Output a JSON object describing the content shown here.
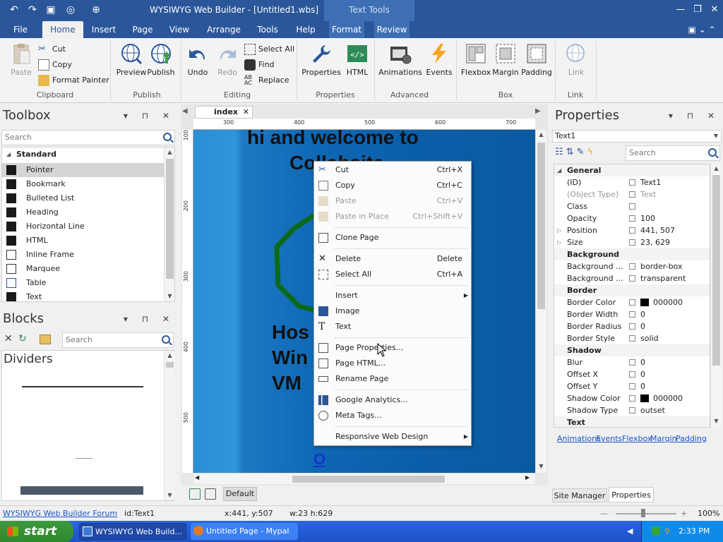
{
  "window": {
    "title": "WYSIWYG Web Builder - [Untitled1.wbs]",
    "context_tab": "Text Tools",
    "min": "—",
    "restore": "❐",
    "close": "✕"
  },
  "ribbon_tabs": [
    "File",
    "Home",
    "Insert",
    "Page",
    "View",
    "Arrange",
    "Tools",
    "Help",
    "Format",
    "Review"
  ],
  "ribbon": {
    "clipboard": {
      "paste": "Paste",
      "cut": "Cut",
      "copy": "Copy",
      "format_painter": "Format Painter",
      "label": "Clipboard"
    },
    "publish": {
      "preview": "Preview",
      "publish": "Publish",
      "label": "Publish"
    },
    "editing": {
      "undo": "Undo",
      "redo": "Redo",
      "select_all": "Select All",
      "find": "Find",
      "replace": "Replace",
      "label": "Editing"
    },
    "properties": {
      "properties": "Properties",
      "html": "HTML",
      "label": "Properties"
    },
    "advanced": {
      "animations": "Animations",
      "events": "Events",
      "label": "Advanced"
    },
    "box": {
      "flexbox": "Flexbox",
      "margin": "Margin",
      "padding": "Padding",
      "label": "Box"
    },
    "link": {
      "link": "Link",
      "label": "Link"
    }
  },
  "toolbox": {
    "title": "Toolbox",
    "search_placeholder": "Search",
    "category": "Standard",
    "items": [
      "Pointer",
      "Bookmark",
      "Bulleted List",
      "Heading",
      "Horizontal Line",
      "HTML",
      "Inline Frame",
      "Marquee",
      "Table",
      "Text"
    ]
  },
  "blocks": {
    "title": "Blocks",
    "search_placeholder": "Search",
    "category": "Dividers"
  },
  "document": {
    "tab": "index",
    "ruler_h": [
      "300",
      "400",
      "500",
      "600",
      "700"
    ],
    "ruler_v": [
      "100",
      "200",
      "300",
      "400",
      "500"
    ],
    "heading1": "hi and welcome to",
    "heading2": "Collabsite",
    "side_text1": "Hos",
    "side_text2": "Win",
    "side_text3": "VM",
    "link_text": "O",
    "layer": "Default"
  },
  "context_menu": {
    "items": [
      {
        "label": "Cut",
        "shortcut": "Ctrl+X",
        "enabled": true
      },
      {
        "label": "Copy",
        "shortcut": "Ctrl+C",
        "enabled": true
      },
      {
        "label": "Paste",
        "shortcut": "Ctrl+V",
        "enabled": false
      },
      {
        "label": "Paste in Place",
        "shortcut": "Ctrl+Shift+V",
        "enabled": false
      },
      {
        "label": "Clone Page",
        "shortcut": "",
        "enabled": true
      },
      {
        "label": "Delete",
        "shortcut": "Delete",
        "enabled": true
      },
      {
        "label": "Select All",
        "shortcut": "Ctrl+A",
        "enabled": true
      },
      {
        "label": "Insert",
        "shortcut": "",
        "enabled": true
      },
      {
        "label": "Image",
        "shortcut": "",
        "enabled": true
      },
      {
        "label": "Text",
        "shortcut": "",
        "enabled": true
      },
      {
        "label": "Page Properties...",
        "shortcut": "",
        "enabled": true
      },
      {
        "label": "Page HTML...",
        "shortcut": "",
        "enabled": true
      },
      {
        "label": "Rename Page",
        "shortcut": "",
        "enabled": true
      },
      {
        "label": "Google Analytics...",
        "shortcut": "",
        "enabled": true
      },
      {
        "label": "Meta Tags...",
        "shortcut": "",
        "enabled": true
      },
      {
        "label": "Responsive Web Design",
        "shortcut": "",
        "enabled": true
      }
    ]
  },
  "properties": {
    "title": "Properties",
    "object": "Text1",
    "search_placeholder": "Search",
    "rows": [
      {
        "cat": "General"
      },
      {
        "name": "(ID)",
        "value": "Text1"
      },
      {
        "name": "(Object Type)",
        "value": "Text",
        "dim": true
      },
      {
        "name": "Class",
        "value": ""
      },
      {
        "name": "Opacity",
        "value": "100"
      },
      {
        "name": "Position",
        "value": "441, 507",
        "expand": true
      },
      {
        "name": "Size",
        "value": "23, 629",
        "expand": true
      },
      {
        "cat": "Background"
      },
      {
        "name": "Background ...",
        "value": "border-box"
      },
      {
        "name": "Background ...",
        "value": "transparent"
      },
      {
        "cat": "Border"
      },
      {
        "name": "Border Color",
        "value": "000000",
        "swatch": "#000000"
      },
      {
        "name": "Border Width",
        "value": "0"
      },
      {
        "name": "Border Radius",
        "value": "0"
      },
      {
        "name": "Border Style",
        "value": "solid"
      },
      {
        "cat": "Shadow"
      },
      {
        "name": "Blur",
        "value": "0"
      },
      {
        "name": "Offset X",
        "value": "0"
      },
      {
        "name": "Offset Y",
        "value": "0"
      },
      {
        "name": "Shadow Color",
        "value": "000000",
        "swatch": "#000000"
      },
      {
        "name": "Shadow Type",
        "value": "outset"
      },
      {
        "cat": "Text"
      }
    ],
    "links": [
      "Animations",
      "Events",
      "Flexbox",
      "Margin",
      "Padding"
    ],
    "tabs": [
      "Site Manager",
      "Properties"
    ]
  },
  "status": {
    "forum_link": "WYSIWYG Web Builder Forum",
    "id": "id:Text1",
    "xy": "x:441, y:507",
    "wh": "w:23 h:629",
    "zoom": "100%",
    "zoom_minus": "—",
    "zoom_plus": "+"
  },
  "taskbar": {
    "start": "start",
    "tasks": [
      "WYSIWYG Web Build...",
      "Untitled Page - Mypal"
    ],
    "time": "2:33 PM"
  }
}
